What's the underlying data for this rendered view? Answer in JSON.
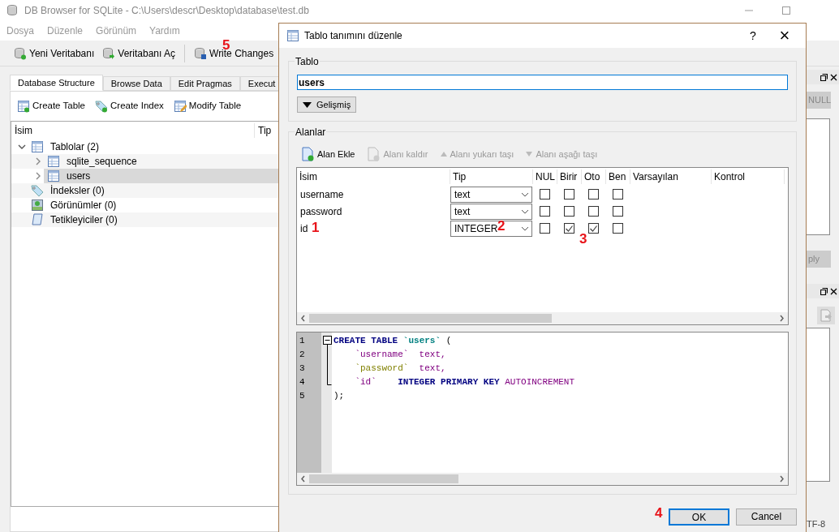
{
  "window": {
    "title": "DB Browser for SQLite - C:\\Users\\descr\\Desktop\\database\\test.db"
  },
  "menu": [
    "Dosya",
    "Düzenle",
    "Görünüm",
    "Yardım"
  ],
  "toolbar": [
    {
      "label": "Yeni Veritabanı",
      "kind": "new"
    },
    {
      "label": "Veritabanı Aç",
      "kind": "open"
    },
    {
      "label": "Write Changes",
      "kind": "write"
    }
  ],
  "tabs": [
    {
      "label": "Database Structure",
      "selected": true
    },
    {
      "label": "Browse Data",
      "selected": false
    },
    {
      "label": "Edit Pragmas",
      "selected": false
    },
    {
      "label": "Execut",
      "selected": false
    }
  ],
  "structure_toolbar": [
    {
      "label": "Create Table",
      "kind": "table"
    },
    {
      "label": "Create Index",
      "kind": "index"
    },
    {
      "label": "Modify Table",
      "kind": "modify"
    }
  ],
  "tree": {
    "columns": [
      "İsim",
      "Tip"
    ],
    "items": [
      {
        "label": "Tablolar (2)",
        "kind": "table",
        "expanded": true,
        "selected": false,
        "children": [
          {
            "label": "sqlite_sequence",
            "kind": "table",
            "expanded": false,
            "selected": false
          },
          {
            "label": "users",
            "kind": "table",
            "expanded": false,
            "selected": true
          }
        ]
      },
      {
        "label": "İndeksler (0)",
        "kind": "index",
        "selected": false
      },
      {
        "label": "Görünümler (0)",
        "kind": "view",
        "selected": false
      },
      {
        "label": "Tetikleyiciler (0)",
        "kind": "trigger",
        "selected": false
      }
    ]
  },
  "dock": {
    "null_button": "NULL",
    "apply_button": "ply"
  },
  "status_bar": {
    "encoding": "TF-8"
  },
  "dialog": {
    "title": "Tablo tanımını düzenle",
    "help": "?",
    "close": "×",
    "table_group": {
      "title": "Tablo",
      "name_value": "users",
      "advanced_button": "Gelişmiş"
    },
    "fields_group": {
      "title": "Alanlar",
      "actions": [
        {
          "label": "Alan Ekle",
          "kind": "add",
          "disabled": false
        },
        {
          "label": "Alanı kaldır",
          "kind": "remove",
          "disabled": true
        },
        {
          "label": "Alanı yukarı taşı",
          "kind": "up",
          "disabled": true
        },
        {
          "label": "Alanı aşağı taşı",
          "kind": "down",
          "disabled": true
        }
      ],
      "columns": [
        "İsim",
        "Tip",
        "NUL",
        "Birir",
        "Oto",
        "Ben",
        "Varsayılan",
        "Kontrol"
      ],
      "fields": [
        {
          "name": "username",
          "type": "text",
          "not_null": false,
          "primary_key": false,
          "autoincrement": false,
          "unique": false
        },
        {
          "name": "password",
          "type": "text",
          "not_null": false,
          "primary_key": false,
          "autoincrement": false,
          "unique": false
        },
        {
          "name": "id",
          "type": "INTEGER",
          "not_null": false,
          "primary_key": true,
          "autoincrement": true,
          "unique": false
        }
      ]
    },
    "sql": [
      {
        "number": "1",
        "tokens": [
          {
            "text": "CREATE TABLE ",
            "kind": "keyword"
          },
          {
            "text": "`users`",
            "kind": "table"
          },
          {
            "text": " (",
            "kind": "plain"
          }
        ]
      },
      {
        "number": "2",
        "tokens": [
          {
            "text": "    `username`",
            "kind": "column"
          },
          {
            "text": "  text,",
            "kind": "type"
          }
        ]
      },
      {
        "number": "3",
        "tokens": [
          {
            "text": "    `password`",
            "kind": "column_marked"
          },
          {
            "text": "  text,",
            "kind": "type"
          }
        ]
      },
      {
        "number": "4",
        "tokens": [
          {
            "text": "    `id`",
            "kind": "column"
          },
          {
            "text": "    INTEGER PRIMARY KEY ",
            "kind": "keyword"
          },
          {
            "text": "AUTOINCREMENT",
            "kind": "type"
          }
        ]
      },
      {
        "number": "5",
        "tokens": [
          {
            "text": ");",
            "kind": "plain"
          }
        ]
      }
    ],
    "buttons": [
      {
        "label": "OK",
        "kind": "default"
      },
      {
        "label": "Cancel",
        "kind": "normal"
      }
    ]
  },
  "annotations": [
    "5",
    "1",
    "2",
    "3",
    "4"
  ]
}
